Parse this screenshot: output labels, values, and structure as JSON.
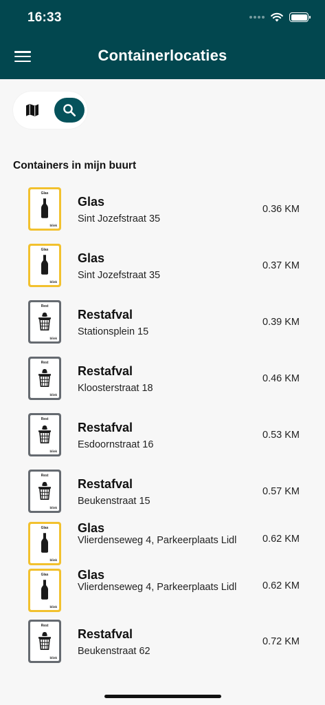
{
  "status_bar": {
    "time": "16:33"
  },
  "app_bar": {
    "title": "Containerlocaties",
    "menu_icon": "menu-icon"
  },
  "view_toggle": {
    "map_icon": "map-icon",
    "search_icon": "search-icon"
  },
  "section_title": "Containers in mijn buurt",
  "containers": [
    {
      "type": "glas",
      "badge_label": "Glas",
      "brand": "blink",
      "name": "Glas",
      "address": "Sint Jozefstraat 35",
      "distance": "0.36 KM"
    },
    {
      "type": "glas",
      "badge_label": "Glas",
      "brand": "blink",
      "name": "Glas",
      "address": "Sint Jozefstraat 35",
      "distance": "0.37 KM"
    },
    {
      "type": "rest",
      "badge_label": "Rest",
      "brand": "blink",
      "name": "Restafval",
      "address": "Stationsplein 15",
      "distance": "0.39 KM"
    },
    {
      "type": "rest",
      "badge_label": "Rest",
      "brand": "blink",
      "name": "Restafval",
      "address": "Kloosterstraat 18",
      "distance": "0.46 KM"
    },
    {
      "type": "rest",
      "badge_label": "Rest",
      "brand": "blink",
      "name": "Restafval",
      "address": "Esdoornstraat 16",
      "distance": "0.53 KM"
    },
    {
      "type": "rest",
      "badge_label": "Rest",
      "brand": "blink",
      "name": "Restafval",
      "address": "Beukenstraat 15",
      "distance": "0.57 KM"
    },
    {
      "type": "glas",
      "badge_label": "Glas",
      "brand": "blink",
      "name": "Glas",
      "address": "Vlierdenseweg 4, Parkeerplaats Lidl",
      "distance": "0.62 KM"
    },
    {
      "type": "glas",
      "badge_label": "Glas",
      "brand": "blink",
      "name": "Glas",
      "address": "Vlierdenseweg 4, Parkeerplaats Lidl",
      "distance": "0.62 KM"
    },
    {
      "type": "rest",
      "badge_label": "Rest",
      "brand": "blink",
      "name": "Restafval",
      "address": "Beukenstraat 62",
      "distance": "0.72 KM"
    }
  ],
  "colors": {
    "app_bar": "#02474f",
    "search_active": "#05525b",
    "glas": "#f2c12e",
    "rest": "#656a70"
  }
}
